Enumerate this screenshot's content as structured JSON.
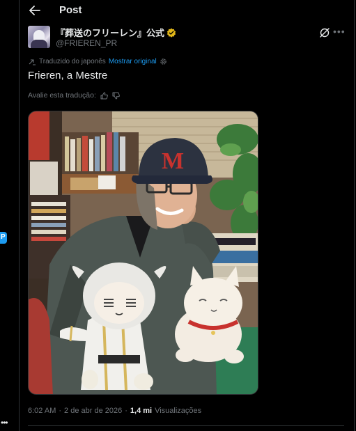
{
  "header": {
    "title": "Post"
  },
  "author": {
    "name": "『葬送のフリーレン』公式",
    "handle": "@FRIEREN_PR"
  },
  "translation": {
    "note": "Traduzido do japonês",
    "show_original": "Mostrar original",
    "rate_prompt": "Avalie esta tradução:"
  },
  "post": {
    "text": "Frieren, a Mestre"
  },
  "meta": {
    "time": "6:02 AM",
    "separator": "·",
    "date": "2 de abr de 2026",
    "views_count": "1,4 mi",
    "views_label": "Visualizações"
  },
  "colors": {
    "background": "#000000",
    "text": "#e7e9ea",
    "muted": "#71767b",
    "accent": "#1d9bf0",
    "verified_gold": "#e2b719"
  }
}
